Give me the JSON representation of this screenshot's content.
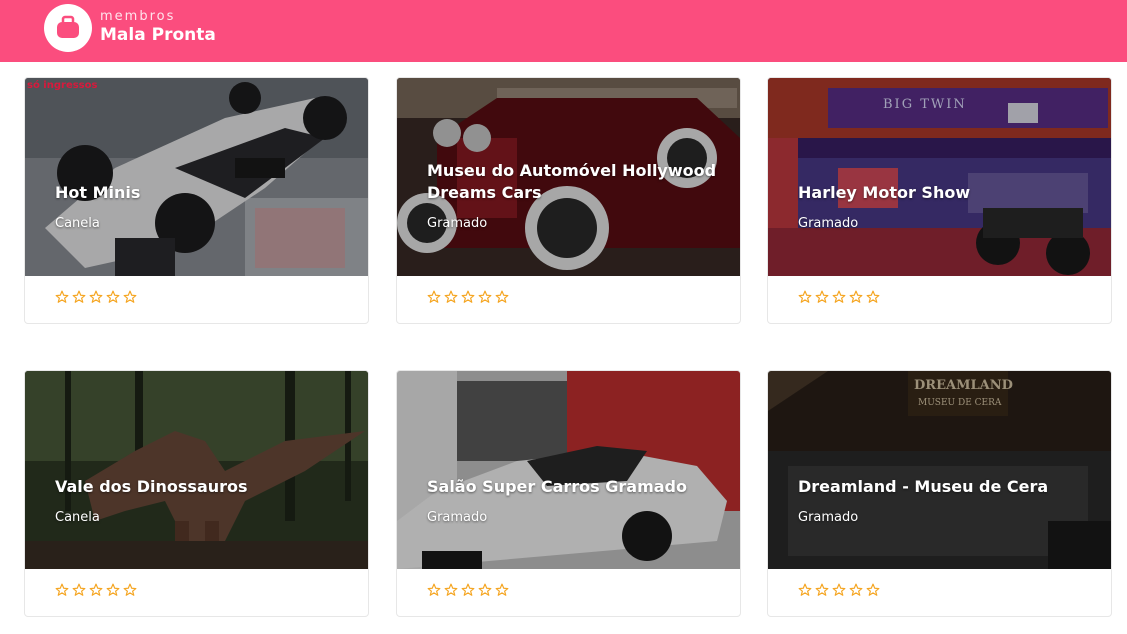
{
  "header": {
    "brand_small": "membros",
    "brand_big": "Mala Pronta",
    "brand_color": "#fb4d7e",
    "logo_icon": "suitcase-icon"
  },
  "cards": [
    {
      "title": "Hot Minis",
      "city": "Canela",
      "rating": 0,
      "image": "formula-one-model-car",
      "badge": "só ingressos"
    },
    {
      "title": "Museu do Automóvel Hollywood Dreams Cars",
      "city": "Gramado",
      "rating": 0,
      "image": "vintage-red-car"
    },
    {
      "title": "Harley Motor Show",
      "city": "Gramado",
      "rating": 0,
      "image": "motorcycle-showroom"
    },
    {
      "title": "Vale dos Dinossauros",
      "city": "Canela",
      "rating": 0,
      "image": "dinosaur-statue-forest"
    },
    {
      "title": "Salão Super Carros Gramado",
      "city": "Gramado",
      "rating": 0,
      "image": "white-sports-car"
    },
    {
      "title": "Dreamland - Museu de Cera",
      "city": "Gramado",
      "rating": 0,
      "image": "wax-museum-facade"
    }
  ],
  "star_color": "#f5a623",
  "star_icon": "star-outline-icon"
}
